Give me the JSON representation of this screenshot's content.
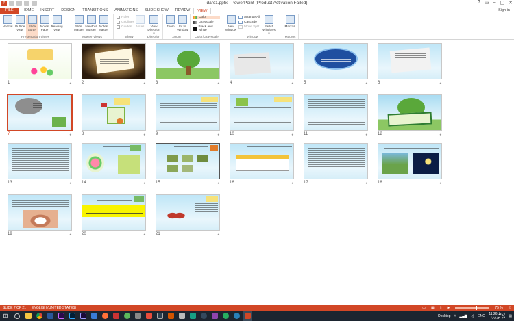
{
  "window": {
    "title": "darc1.pptx - PowerPoint (Product Activation Failed)",
    "signin": "Sign in",
    "buttons": [
      "?",
      "▭",
      "–",
      "▢",
      "✕"
    ]
  },
  "tabs": [
    "FILE",
    "HOME",
    "INSERT",
    "DESIGN",
    "TRANSITIONS",
    "ANIMATIONS",
    "SLIDE SHOW",
    "REVIEW",
    "VIEW"
  ],
  "active_tab": "VIEW",
  "ribbon": {
    "presentation_views": {
      "label": "Presentation Views",
      "buttons": [
        "Normal",
        "Outline View",
        "Slide Sorter",
        "Notes Page",
        "Reading View"
      ]
    },
    "master_views": {
      "label": "Master Views",
      "buttons": [
        "Slide Master",
        "Handout Master",
        "Notes Master"
      ]
    },
    "show": {
      "label": "Show",
      "items": [
        "Ruler",
        "Gridlines",
        "Guides"
      ],
      "notes": "Notes"
    },
    "direction": {
      "label": "Direction",
      "button": "View Direction ▾"
    },
    "zoom": {
      "label": "Zoom",
      "buttons": [
        "Zoom",
        "Fit to Window"
      ]
    },
    "color": {
      "label": "Color/Grayscale",
      "items": [
        "Color",
        "Grayscale",
        "Black and White"
      ]
    },
    "window_group": {
      "label": "Window",
      "new_window": "New Window",
      "items": [
        "Arrange All",
        "Cascade",
        "Move Split"
      ],
      "switch": "Switch Windows ▾"
    },
    "macros": {
      "label": "Macros",
      "button": "Macros"
    }
  },
  "slides": [
    {
      "n": "1"
    },
    {
      "n": "2"
    },
    {
      "n": "3"
    },
    {
      "n": "4"
    },
    {
      "n": "5"
    },
    {
      "n": "6"
    },
    {
      "n": "7"
    },
    {
      "n": "8"
    },
    {
      "n": "9"
    },
    {
      "n": "10"
    },
    {
      "n": "11"
    },
    {
      "n": "12"
    },
    {
      "n": "13"
    },
    {
      "n": "14"
    },
    {
      "n": "15"
    },
    {
      "n": "16"
    },
    {
      "n": "17"
    },
    {
      "n": "18"
    },
    {
      "n": "19"
    },
    {
      "n": "20"
    },
    {
      "n": "21"
    }
  ],
  "selected_slide": 7,
  "status": {
    "slide": "SLIDE 7 OF 21",
    "language": "ENGLISH (UNITED STATES)",
    "zoom": "75 %"
  },
  "taskbar": {
    "desktop": "Desktop",
    "lang": "ENG",
    "time": "11:26 ق.ظ",
    "date": "۰۶/۱۱/۲۰۲۴"
  },
  "colors": {
    "accent": "#d24726",
    "taskbar": "#1c2530"
  }
}
